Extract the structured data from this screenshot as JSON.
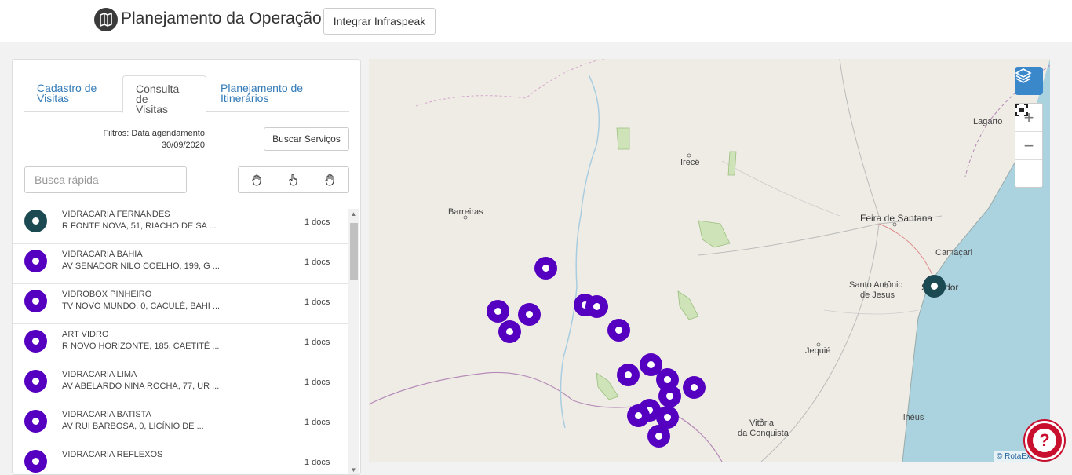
{
  "header": {
    "title": "Planejamento da Operação",
    "integrar_label": "Integrar Infraspeak"
  },
  "tabs": [
    {
      "line1": "Cadastro de",
      "line2": "Visitas"
    },
    {
      "line1": "Consulta de",
      "line2": "Visitas"
    },
    {
      "line1": "Planejamento de",
      "line2": "Itinerários"
    }
  ],
  "filters": {
    "line1": "Filtros: Data agendamento",
    "line2": "30/09/2020",
    "buscar_label": "Buscar Serviços"
  },
  "search": {
    "placeholder": "Busca rápida"
  },
  "visits": [
    {
      "name": "VIDRACARIA FERNANDES",
      "address": "R FONTE NOVA, 51, RIACHO DE SA ...",
      "docs": "1 docs",
      "selected": true
    },
    {
      "name": "VIDRACARIA BAHIA",
      "address": "AV SENADOR NILO COELHO, 199, G ...",
      "docs": "1 docs"
    },
    {
      "name": "VIDROBOX PINHEIRO",
      "address": "TV NOVO MUNDO, 0, CACULÉ, BAHI ...",
      "docs": "1 docs"
    },
    {
      "name": "ART VIDRO",
      "address": "R NOVO HORIZONTE, 185, CAETITÉ ...",
      "docs": "1 docs"
    },
    {
      "name": "VIDRACARIA LIMA",
      "address": "AV ABELARDO NINA ROCHA, 77, UR ...",
      "docs": "1 docs"
    },
    {
      "name": "VIDRACARIA BATISTA",
      "address": "AV RUI BARBOSA, 0, LICÍNIO DE ...",
      "docs": "1 docs"
    },
    {
      "name": "VIDRACARIA REFLEXOS",
      "address": "",
      "docs": "1 docs"
    }
  ],
  "map": {
    "labels": {
      "lagarto": "Lagarto",
      "irece": "Irecê",
      "barreiras": "Barreiras",
      "feira": "Feira de Santana",
      "camacari": "Camaçari",
      "santo_antonio_1": "Santo Antônio",
      "santo_antonio_2": "de Jesus",
      "salvador": "Salvador",
      "jequie": "Jequié",
      "vitoria_1": "Vitória",
      "vitoria_2": "da Conquista",
      "ilheus": "Ilhéus"
    },
    "zoom_in": "+",
    "zoom_out": "−",
    "attribution": "© RotaExata"
  },
  "help_label": "?"
}
